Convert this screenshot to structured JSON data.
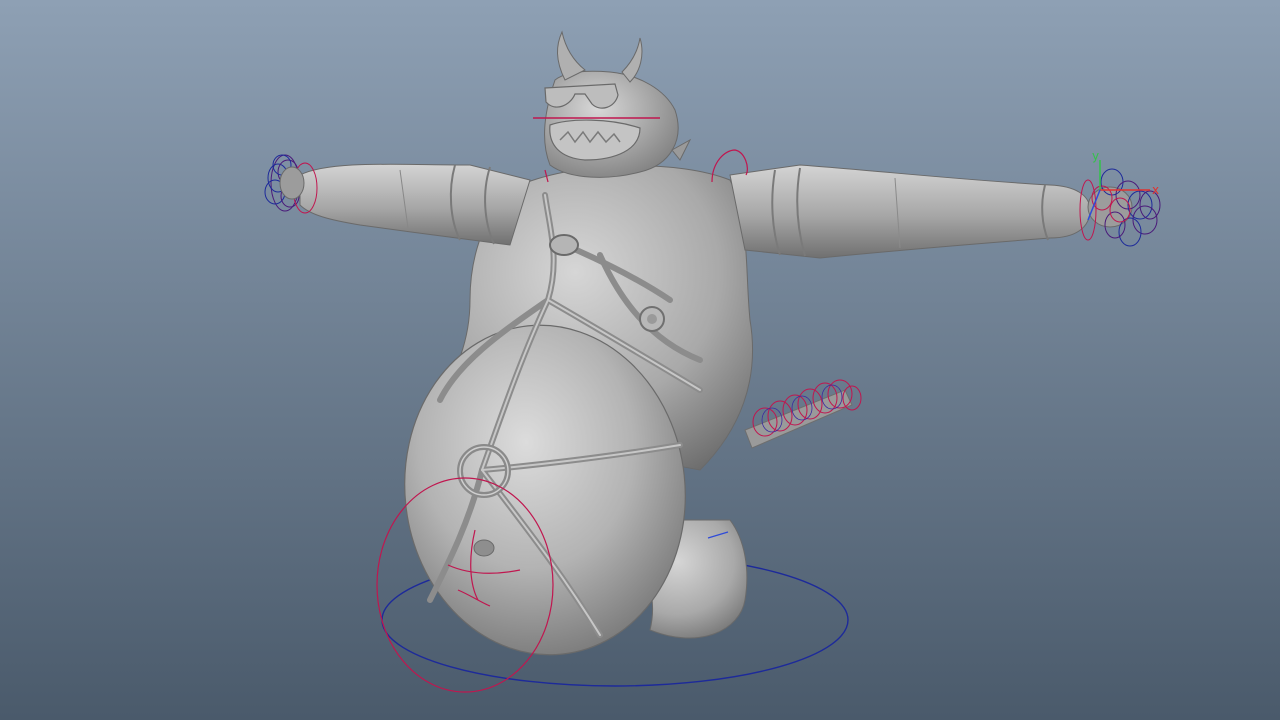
{
  "viewport": {
    "background_top": "#8ea0b4",
    "background_bottom": "#4a5a6b"
  },
  "axis_labels": {
    "x": "x",
    "y": "y"
  },
  "colors": {
    "axis_x": "#e2312e",
    "axis_y": "#33c24a",
    "axis_z": "#2f4bd8",
    "control_red": "#c0164f",
    "control_dark_red": "#8a0a36",
    "control_blue": "#1d2a9a",
    "control_purple": "#4a1a7a",
    "mesh_light": "#c9c9c9",
    "mesh_mid": "#a8a8a8",
    "mesh_dark": "#7a7a7a"
  },
  "icons": {
    "axis_gizmo": "axis-gizmo-icon"
  }
}
